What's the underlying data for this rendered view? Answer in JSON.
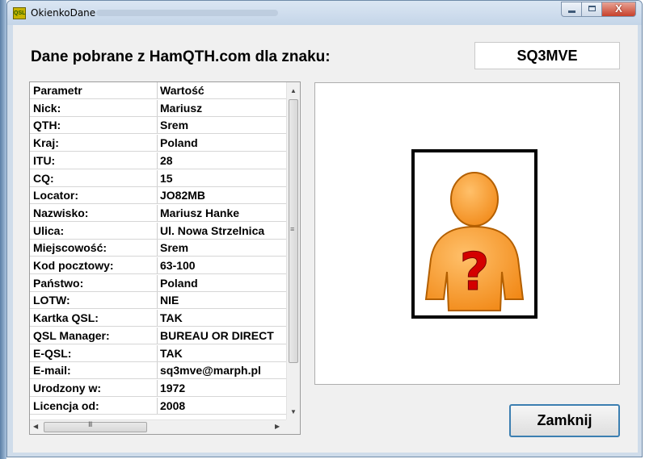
{
  "window": {
    "title": "OkienkoDane",
    "app_icon_text": "QSL",
    "close_glyph": "X"
  },
  "header": {
    "heading": "Dane pobrane z HamQTH.com dla znaku:",
    "callsign": "SQ3MVE"
  },
  "table": {
    "columns": [
      "Parametr",
      "Wartość"
    ],
    "rows": [
      [
        "Nick:",
        "Mariusz"
      ],
      [
        "QTH:",
        "Srem"
      ],
      [
        "Kraj:",
        "Poland"
      ],
      [
        "ITU:",
        "28"
      ],
      [
        "CQ:",
        "15"
      ],
      [
        "Locator:",
        "JO82MB"
      ],
      [
        "Nazwisko:",
        "Mariusz Hanke"
      ],
      [
        "Ulica:",
        "Ul. Nowa Strzelnica"
      ],
      [
        "Miejscowość:",
        "Srem"
      ],
      [
        "Kod pocztowy:",
        "63-100"
      ],
      [
        "Państwo:",
        "Poland"
      ],
      [
        "LOTW:",
        "NIE"
      ],
      [
        "Kartka QSL:",
        "TAK"
      ],
      [
        "QSL Manager:",
        "BUREAU OR DIRECT"
      ],
      [
        "E-QSL:",
        "TAK"
      ],
      [
        "E-mail:",
        "sq3mve@marph.pl"
      ],
      [
        "Urodzony w:",
        "1972"
      ],
      [
        "Licencja od:",
        "2008"
      ]
    ]
  },
  "photo": {
    "icon": "unknown-person-icon",
    "glyph": "?"
  },
  "buttons": {
    "close_label": "Zamknij"
  },
  "colors": {
    "person": "#f7931e",
    "question_mark": "#d40000",
    "button_border": "#3c7fb1"
  }
}
